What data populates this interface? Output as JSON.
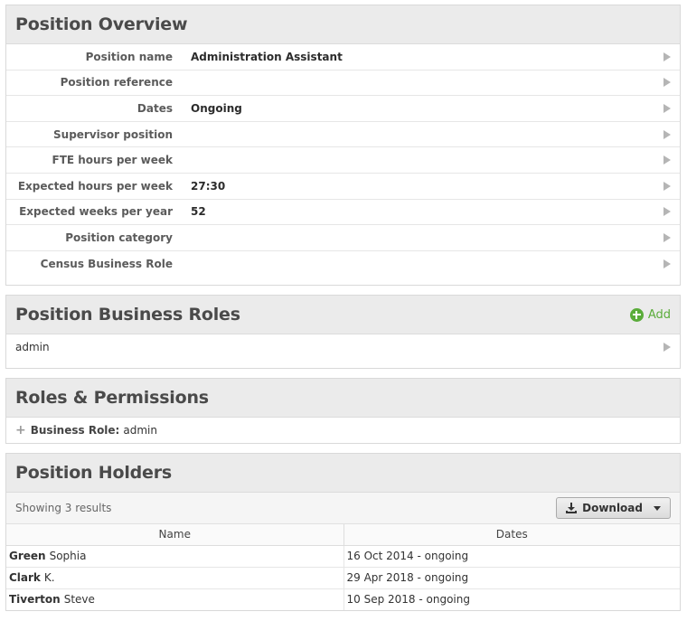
{
  "overview": {
    "title": "Position Overview",
    "fields": [
      {
        "label": "Position name",
        "value": "Administration Assistant"
      },
      {
        "label": "Position reference",
        "value": ""
      },
      {
        "label": "Dates",
        "value": "Ongoing"
      },
      {
        "label": "Supervisor position",
        "value": ""
      },
      {
        "label": "FTE hours per week",
        "value": ""
      },
      {
        "label": "Expected hours per week",
        "value": "27:30"
      },
      {
        "label": "Expected weeks per year",
        "value": "52"
      },
      {
        "label": "Position category",
        "value": ""
      },
      {
        "label": "Census Business Role",
        "value": ""
      }
    ]
  },
  "business_roles": {
    "title": "Position Business Roles",
    "add_label": "Add",
    "items": [
      "admin"
    ]
  },
  "permissions": {
    "title": "Roles & Permissions",
    "business_role_label": "Business Role:",
    "business_role_value": "admin"
  },
  "holders": {
    "title": "Position Holders",
    "showing": "Showing 3 results",
    "download_label": "Download",
    "columns": [
      "Name",
      "Dates"
    ],
    "rows": [
      {
        "surname": "Green",
        "forename": "Sophia",
        "dates": "16 Oct 2014 - ongoing"
      },
      {
        "surname": "Clark",
        "forename": "K.",
        "dates": "29 Apr 2018 - ongoing"
      },
      {
        "surname": "Tiverton",
        "forename": "Steve",
        "dates": "10 Sep 2018 - ongoing"
      }
    ]
  },
  "colors": {
    "accent_green": "#5aac3a",
    "header_bg": "#ebebeb"
  },
  "icons": [
    "row-arrow-icon",
    "plus-circle-icon",
    "expand-plus-icon",
    "download-icon",
    "caret-down-icon"
  ]
}
